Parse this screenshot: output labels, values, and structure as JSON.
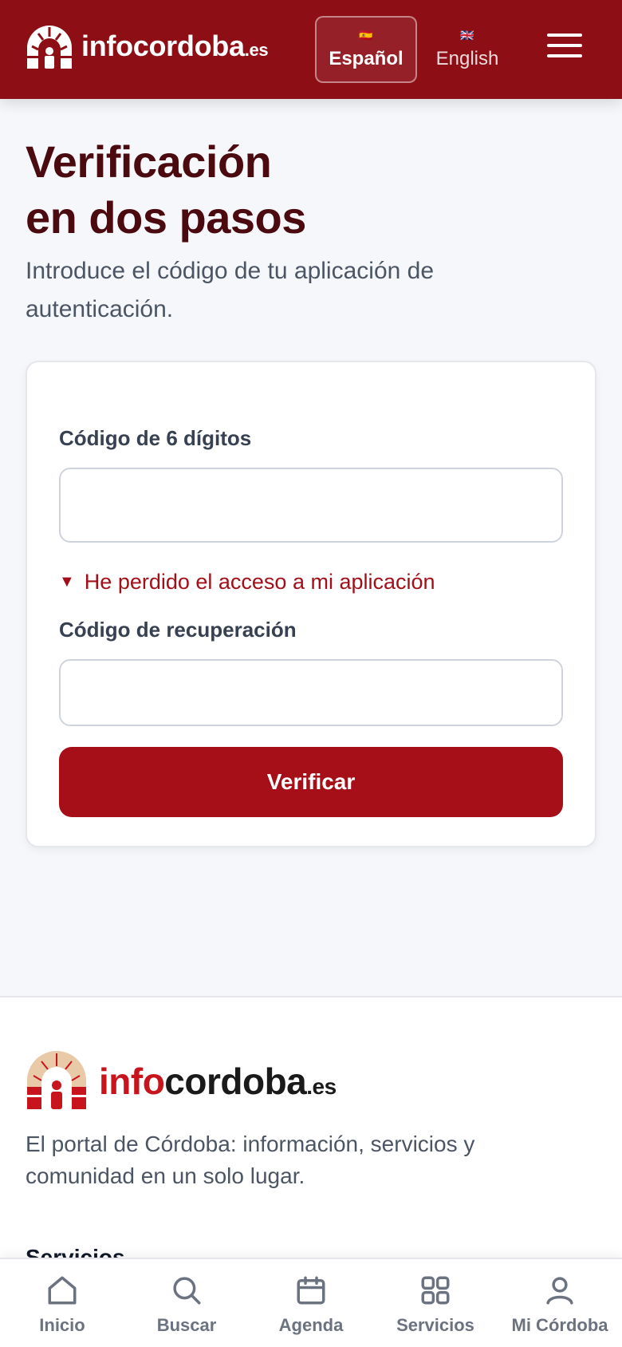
{
  "header": {
    "logo_text": "infocordoba",
    "logo_tld": ".es",
    "languages": [
      {
        "flag": "🇪🇸",
        "label": "Español",
        "active": true
      },
      {
        "flag": "🇬🇧",
        "label": "English",
        "active": false
      }
    ],
    "menu_icon": "hamburger-menu-icon"
  },
  "page": {
    "title_line1": "Verificación",
    "title_line2": "en dos pasos",
    "subtitle": "Introduce el código de tu aplicación de autenticación."
  },
  "form": {
    "code_label": "Código de 6 dígitos",
    "code_value": "",
    "lost_access_toggle": "He perdido el acceso a mi aplicación",
    "recovery_label": "Código de recuperación",
    "recovery_value": "",
    "submit_label": "Verificar"
  },
  "footer": {
    "logo_red": "info",
    "logo_dark": "cordoba",
    "logo_tld": ".es",
    "tagline": "El portal de Córdoba: información, servicios y comunidad en un solo lugar.",
    "section_heading": "Servicios"
  },
  "bottom_nav": [
    {
      "label": "Inicio",
      "icon": "home-icon"
    },
    {
      "label": "Buscar",
      "icon": "search-icon"
    },
    {
      "label": "Agenda",
      "icon": "calendar-icon"
    },
    {
      "label": "Servicios",
      "icon": "grid-icon"
    },
    {
      "label": "Mi Córdoba",
      "icon": "user-icon"
    }
  ],
  "colors": {
    "brand": "#8e0e15",
    "accent": "#a60e18",
    "title": "#4a0a10"
  }
}
